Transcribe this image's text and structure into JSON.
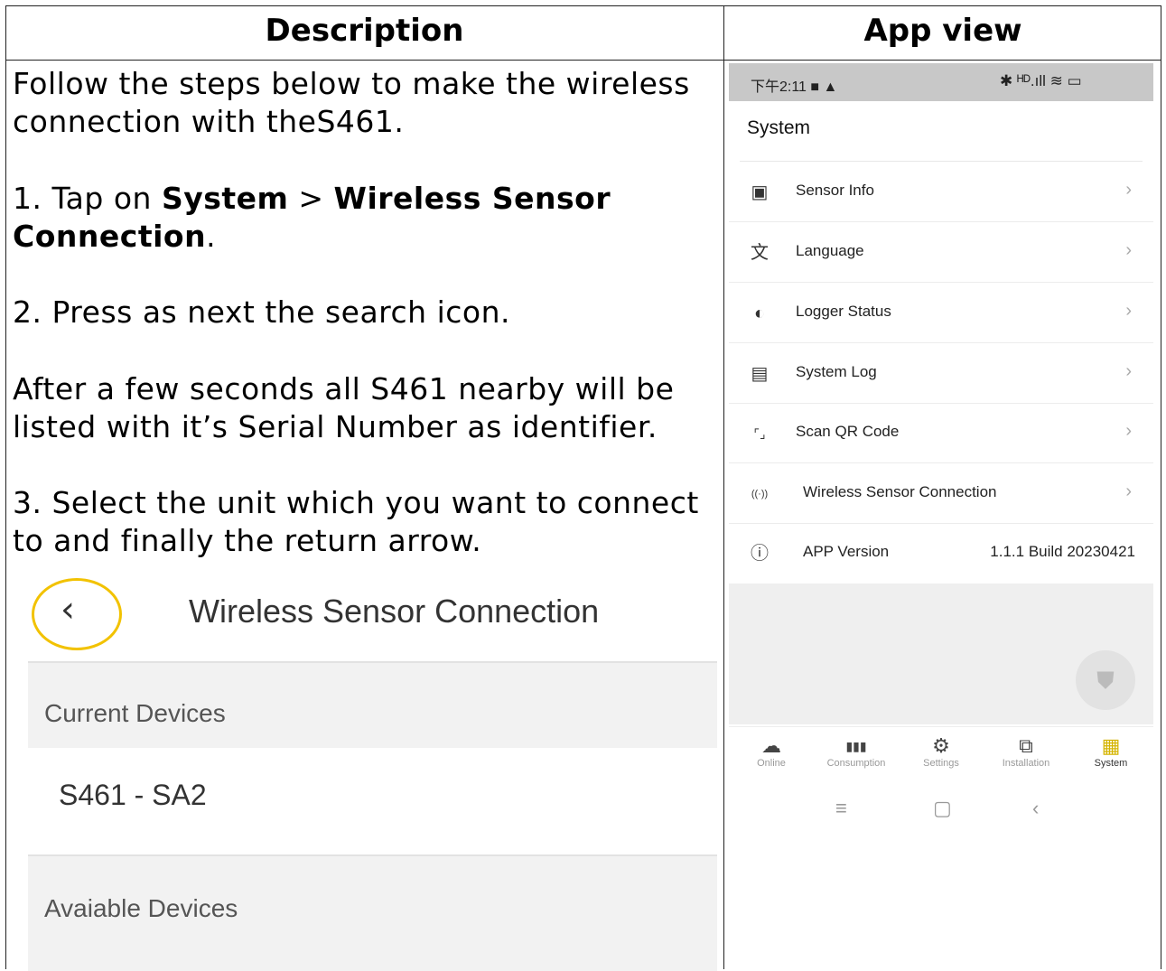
{
  "headers": {
    "description": "Description",
    "app_view": "App view"
  },
  "description": {
    "intro": "Follow the steps below to make the wireless connection with theS461.",
    "step1_prefix": "1. Tap on ",
    "step1_bold1": "System",
    "step1_sep": " > ",
    "step1_bold2": "Wireless Sensor Connection",
    "step1_suffix": ".",
    "step2": "2. Press as next the search icon.",
    "after": "After a few seconds all S461 nearby will be listed with it’s Serial Number as identifier.",
    "step3": "3. Select the unit which you want to connect to and finally the return arrow."
  },
  "inset": {
    "back_glyph": "‹",
    "title": "Wireless Sensor Connection",
    "current_header": "Current Devices",
    "device": "S461 - SA2",
    "available_header": "Avaiable Devices"
  },
  "phone": {
    "status_time": "下午2:11",
    "status_right": "✱ ᴴᴰ.ıll ≋ ▭",
    "title": "System",
    "menu": [
      {
        "icon": "chip-icon",
        "glyph": "▣",
        "label": "Sensor Info"
      },
      {
        "icon": "translate-icon",
        "glyph": "文",
        "label": "Language"
      },
      {
        "icon": "toggle-icon",
        "glyph": "◐",
        "label": "Logger Status"
      },
      {
        "icon": "document-icon",
        "glyph": "▤",
        "label": "System Log"
      },
      {
        "icon": "scan-icon",
        "glyph": "⌜⌟",
        "label": "Scan QR Code"
      },
      {
        "icon": "wireless-icon",
        "glyph": "((·))",
        "label": "Wireless Sensor Connection"
      },
      {
        "icon": "info-icon",
        "glyph": "ⓘ",
        "label": "APP Version",
        "value": "1.1.1 Build 20230421"
      }
    ],
    "chevron": "›",
    "nav": [
      {
        "icon": "cloud-icon",
        "glyph": "☁",
        "label": "Online"
      },
      {
        "icon": "bars-icon",
        "glyph": "▮▮▮",
        "label": "Consumption"
      },
      {
        "icon": "gear-icon",
        "glyph": "⚙",
        "label": "Settings"
      },
      {
        "icon": "installation-icon",
        "glyph": "⧉",
        "label": "Installation"
      },
      {
        "icon": "grid-icon",
        "glyph": "▦",
        "label": "System"
      }
    ],
    "sysbar": [
      "≡",
      "▢",
      "‹"
    ]
  }
}
